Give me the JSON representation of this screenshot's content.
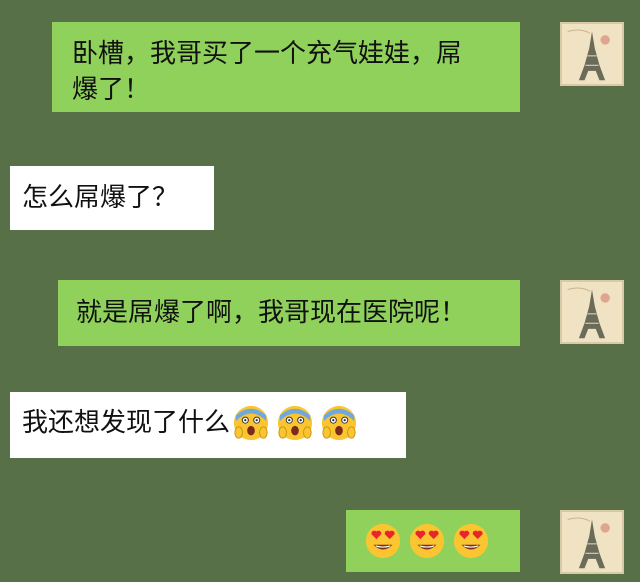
{
  "messages": [
    {
      "side": "out",
      "text_line1": "卧槽，我哥买了一个充气娃娃，屌",
      "text_line2": "爆了！"
    },
    {
      "side": "in",
      "text": "怎么屌爆了？"
    },
    {
      "side": "out",
      "text": "就是屌爆了啊，我哥现在医院呢！"
    },
    {
      "side": "in",
      "text": "我还想发现了什么",
      "emojis": [
        "scream-emoji",
        "scream-emoji",
        "scream-emoji"
      ]
    },
    {
      "side": "out",
      "emojis": [
        "heart-eyes-emoji",
        "heart-eyes-emoji",
        "heart-eyes-emoji"
      ]
    }
  ],
  "colors": {
    "background": "#587047",
    "outgoing_bubble": "#8fd15a",
    "incoming_bubble": "#ffffff"
  }
}
